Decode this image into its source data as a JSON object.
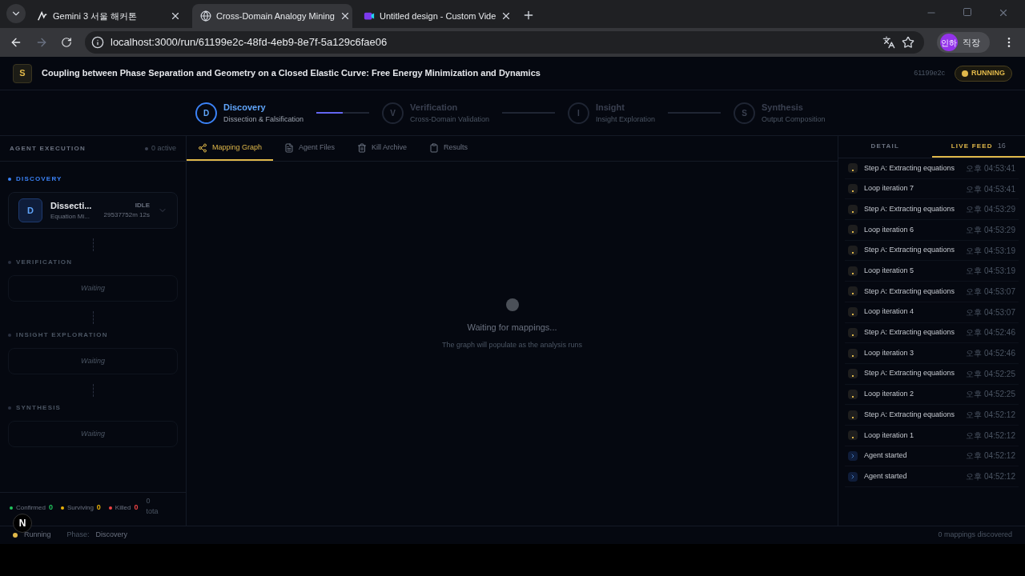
{
  "browser": {
    "tabs": [
      {
        "title": "Gemini 3 서울 해커톤",
        "kind": "gemini",
        "selected": false
      },
      {
        "title": "Cross-Domain Analogy Mining",
        "kind": "globe",
        "selected": true
      },
      {
        "title": "Untitled design - Custom Vide",
        "kind": "canva",
        "selected": false
      }
    ],
    "url": "localhost:3000/run/61199e2c-48fd-4eb9-8e7f-5a129c6fae06",
    "profile_badge": "인하",
    "profile_name": "직장"
  },
  "header": {
    "badge": "S",
    "title": "Coupling between Phase Separation and Geometry on a Closed Elastic Curve: Free Energy Minimization and Dynamics",
    "run_id": "61199e2c",
    "status": "RUNNING"
  },
  "stepper": [
    {
      "letter": "D",
      "title": "Discovery",
      "subtitle": "Dissection & Falsification",
      "selected": true,
      "level": 0.5
    },
    {
      "letter": "V",
      "title": "Verification",
      "subtitle": "Cross-Domain Validation",
      "selected": false
    },
    {
      "letter": "I",
      "title": "Insight",
      "subtitle": "Insight Exploration",
      "selected": false
    },
    {
      "letter": "S",
      "title": "Synthesis",
      "subtitle": "Output Composition",
      "selected": false
    }
  ],
  "sidebar": {
    "title": "AGENT EXECUTION",
    "active_count": "0 active",
    "phases": [
      {
        "name": "DISCOVERY",
        "active": true,
        "agents": [
          {
            "letter": "D",
            "name": "Dissecti...",
            "subtitle": "Equation Mi...",
            "status": "IDLE",
            "elapsed": "29537752m 12s"
          }
        ]
      },
      {
        "name": "VERIFICATION",
        "active": false,
        "waiting": "Waiting"
      },
      {
        "name": "INSIGHT EXPLORATION",
        "active": false,
        "waiting": "Waiting"
      },
      {
        "name": "SYNTHESIS",
        "active": false,
        "waiting": "Waiting"
      }
    ],
    "stats": [
      {
        "label": "Confirmed",
        "value": "0",
        "color": "#22c55e"
      },
      {
        "label": "Surviving",
        "value": "0",
        "color": "#eab308"
      },
      {
        "label": "Killed",
        "value": "0",
        "color": "#ef4444"
      }
    ],
    "total": "0 tota"
  },
  "tabs": [
    {
      "label": "Mapping Graph",
      "kind": "graph",
      "selected": true
    },
    {
      "label": "Agent Files",
      "kind": "file",
      "selected": false
    },
    {
      "label": "Kill Archive",
      "kind": "trash",
      "selected": false
    },
    {
      "label": "Results",
      "kind": "clipboard",
      "selected": false
    }
  ],
  "empty_state": {
    "title": "Waiting for mappings...",
    "subtitle": "The graph will populate as the analysis runs"
  },
  "right_tabs": [
    {
      "label": "DETAIL",
      "selected": false
    },
    {
      "label": "LIVE FEED",
      "count": "16",
      "selected": true
    }
  ],
  "feed": [
    {
      "kind": "step",
      "text": "Step A: Extracting equations",
      "time": "오후 04:53:41"
    },
    {
      "kind": "step",
      "text": "Loop iteration 7",
      "time": "오후 04:53:41"
    },
    {
      "kind": "step",
      "text": "Step A: Extracting equations",
      "time": "오후 04:53:29"
    },
    {
      "kind": "step",
      "text": "Loop iteration 6",
      "time": "오후 04:53:29"
    },
    {
      "kind": "step",
      "text": "Step A: Extracting equations",
      "time": "오후 04:53:19"
    },
    {
      "kind": "step",
      "text": "Loop iteration 5",
      "time": "오후 04:53:19"
    },
    {
      "kind": "step",
      "text": "Step A: Extracting equations",
      "time": "오후 04:53:07"
    },
    {
      "kind": "step",
      "text": "Loop iteration 4",
      "time": "오후 04:53:07"
    },
    {
      "kind": "step",
      "text": "Step A: Extracting equations",
      "time": "오후 04:52:46"
    },
    {
      "kind": "step",
      "text": "Loop iteration 3",
      "time": "오후 04:52:46"
    },
    {
      "kind": "step",
      "text": "Step A: Extracting equations",
      "time": "오후 04:52:25"
    },
    {
      "kind": "step",
      "text": "Loop iteration 2",
      "time": "오후 04:52:25"
    },
    {
      "kind": "step",
      "text": "Step A: Extracting equations",
      "time": "오후 04:52:12"
    },
    {
      "kind": "step",
      "text": "Loop iteration 1",
      "time": "오후 04:52:12"
    },
    {
      "kind": "start",
      "text": "Agent started",
      "time": "오후 04:52:12"
    },
    {
      "kind": "start",
      "text": "Agent started",
      "time": "오후 04:52:12"
    }
  ],
  "footer": {
    "status": "Running",
    "phase_label": "Phase:",
    "phase": "Discovery",
    "mappings": "0 mappings discovered"
  },
  "dev_badge": "N"
}
